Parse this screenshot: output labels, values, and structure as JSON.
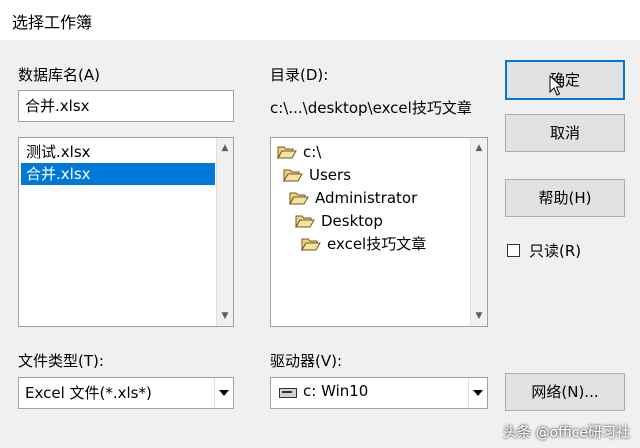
{
  "window": {
    "title": "选择工作簿"
  },
  "database": {
    "label": "数据库名(A)",
    "filename_value": "合并.xlsx",
    "files": [
      {
        "name": "测试.xlsx",
        "selected": false
      },
      {
        "name": "合并.xlsx",
        "selected": true
      }
    ]
  },
  "directory": {
    "label": "目录(D):",
    "current_path": "c:\\...\\desktop\\excel技巧文章",
    "tree": [
      {
        "name": "c:\\",
        "icon": "folder-open-icon"
      },
      {
        "name": "Users",
        "icon": "folder-open-icon"
      },
      {
        "name": "Administrator",
        "icon": "folder-open-icon"
      },
      {
        "name": "Desktop",
        "icon": "folder-open-icon"
      },
      {
        "name": "excel技巧文章",
        "icon": "folder-open-icon"
      }
    ]
  },
  "buttons": {
    "ok": "确定",
    "cancel": "取消",
    "help": "帮助(H)",
    "network": "网络(N)..."
  },
  "readonly": {
    "label": "只读(R)",
    "checked": false
  },
  "filetype": {
    "label": "文件类型(T):",
    "value": "Excel 文件(*.xls*)"
  },
  "drive": {
    "label": "驱动器(V):",
    "value": "c: Win10",
    "icon": "drive-icon"
  },
  "watermark": "头条 @office研习社",
  "colors": {
    "selection": "#0078d7",
    "background": "#f0f0f0",
    "folder": "#f2d27a"
  }
}
